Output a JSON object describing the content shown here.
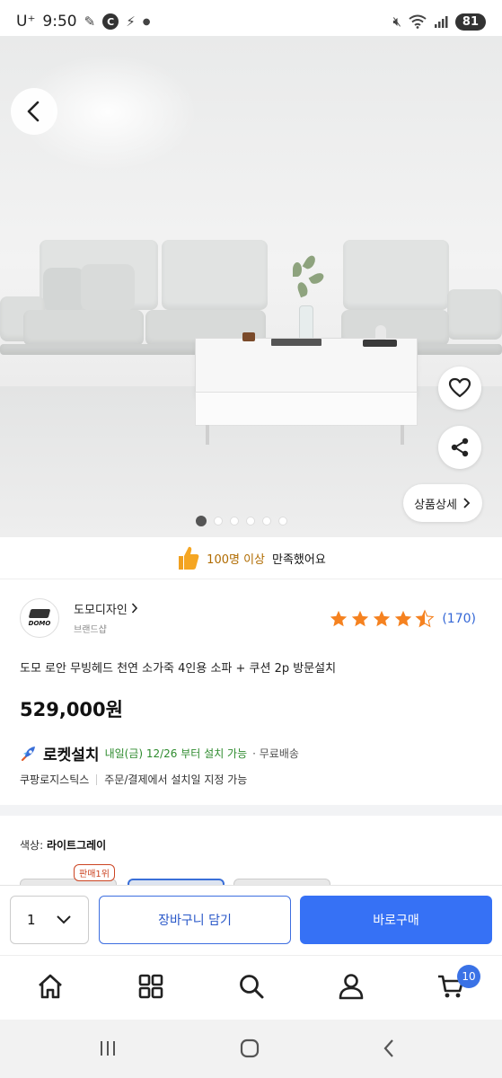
{
  "status_bar": {
    "carrier": "U⁺",
    "time": "9:50",
    "battery": "81",
    "icons": [
      "pen-icon",
      "c-badge-icon",
      "bolt-icon",
      "dot-icon",
      "mute-icon",
      "wifi-icon",
      "signal-icon"
    ]
  },
  "hero": {
    "back_icon": "chevron-left-icon",
    "like_icon": "heart-icon",
    "share_icon": "share-icon",
    "detail_button": "상품상세",
    "carousel_count": 6,
    "carousel_active_index": 0
  },
  "satisfaction": {
    "highlight": "100명 이상",
    "rest": "만족했어요"
  },
  "seller": {
    "logo_text": "DOMO",
    "name": "도모디자인",
    "subtitle": "브랜드샵"
  },
  "rating": {
    "stars": 4.5,
    "count": "(170)"
  },
  "product": {
    "title": "도모 로안 무빙헤드 천연 소가죽 4인용 소파 + 쿠션 2p 방문설치",
    "price": "529,000원"
  },
  "delivery": {
    "label": "로켓설치",
    "date_text": "내일(금) 12/26 부터 설치 가능",
    "shipping": "· 무료배송",
    "logistics": "쿠팡로지스틱스",
    "note": "주문/결제에서 설치일 지정 가능"
  },
  "option": {
    "label": "색상:",
    "value": "라이트그레이",
    "best_badge": "판매1위"
  },
  "action_bar": {
    "quantity": "1",
    "cart_button": "장바구니 담기",
    "buy_button": "바로구매"
  },
  "bottom_nav": {
    "items": [
      "home-icon",
      "category-icon",
      "search-icon",
      "account-icon",
      "cart-icon"
    ],
    "cart_badge": "10"
  },
  "colors": {
    "accent": "#3671f5",
    "rating_star": "#f58220",
    "link_blue": "#3467d6",
    "green": "#2e8b2e"
  }
}
